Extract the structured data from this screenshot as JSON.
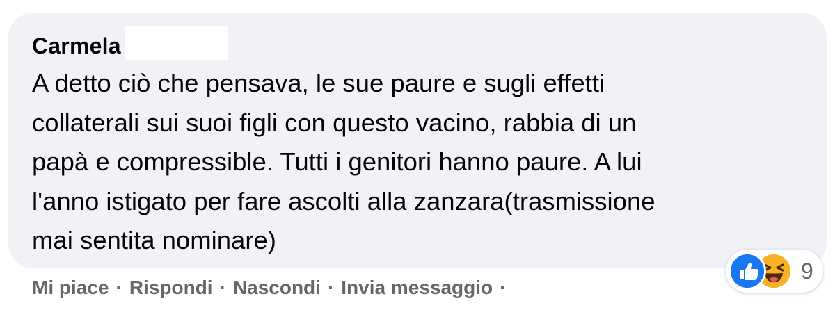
{
  "comment": {
    "author": "Carmela",
    "text": "A detto ciò che pensava, le sue paure e sugli effetti collaterali sui suoi figli con questo vacino, rabbia di un papà e compressible. Tutti i genitori hanno paure. A lui l'anno istigato per fare ascolti alla zanzara(trasmissione mai sentita nominare)",
    "lines": [
      "A detto ciò che pensava, le sue paure e sugli effetti",
      "collaterali sui suoi figli con questo vacino, rabbia di un",
      "papà e compressible. Tutti i genitori hanno paure. A lui",
      "l'anno istigato per fare ascolti alla zanzara(trasmissione",
      "mai sentita nominare)"
    ]
  },
  "reactions": {
    "icons": [
      "like-icon",
      "haha-icon"
    ],
    "count": "9",
    "colors": {
      "like": "#1877f2",
      "haha": "#f7b125"
    }
  },
  "actions": {
    "like": "Mi piace",
    "reply": "Rispondi",
    "hide": "Nascondi",
    "send_message": "Invia messaggio",
    "separator": "·"
  },
  "colors": {
    "bubble_bg": "#f0f2f5",
    "text": "#050505",
    "secondary_text": "#65676b"
  }
}
